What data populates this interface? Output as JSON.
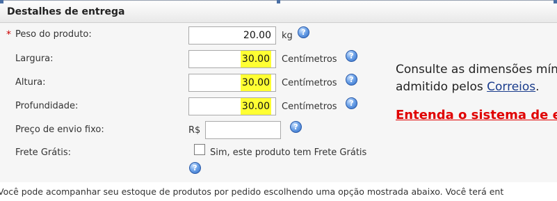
{
  "section": {
    "title": "Destalhes de entrega"
  },
  "required_marker": "*",
  "fields": {
    "peso": {
      "label": "Peso do produto:",
      "value": "20.00",
      "unit": "kg"
    },
    "largura": {
      "label": "Largura:",
      "value": "30.00",
      "unit": "Centímetros"
    },
    "altura": {
      "label": "Altura:",
      "value": "30.00",
      "unit": "Centímetros"
    },
    "profundidade": {
      "label": "Profundidade:",
      "value": "30.00",
      "unit": "Centímetros"
    },
    "preco_fixo": {
      "label": "Preço de envio fixo:",
      "currency": "R$",
      "value": ""
    },
    "frete_gratis": {
      "label": "Frete Grátis:",
      "checkbox_label": "Sim, este produto tem Frete Grátis",
      "checked": false
    }
  },
  "help_glyph": "?",
  "side": {
    "line1": "Consulte as dimensões mín",
    "line2_prefix": "admitido pelos ",
    "line2_link": "Correios",
    "line2_suffix": ".",
    "entenda": "Entenda o sistema de e"
  },
  "bottom_text": "Você pode acompanhar seu estoque de produtos por pedido escolhendo uma opção mostrada abaixo. Você terá ent",
  "colors": {
    "highlight": "#ffff33",
    "required": "#cc0000",
    "link": "#1a3c8c",
    "entenda": "#e00000"
  }
}
